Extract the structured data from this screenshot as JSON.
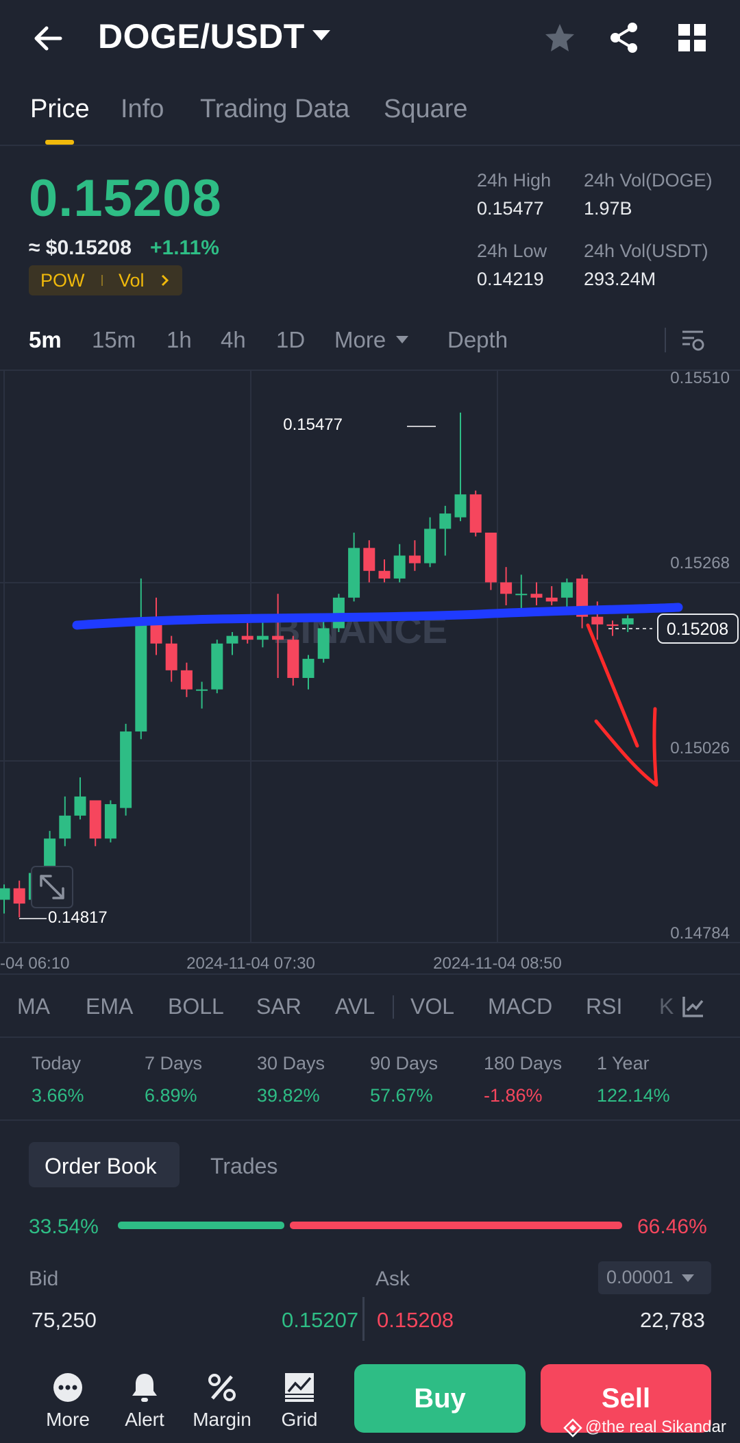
{
  "header": {
    "pair": "DOGE/USDT",
    "icons": [
      "back-arrow-icon",
      "star-icon",
      "share-icon",
      "grid-icon"
    ]
  },
  "tabs": [
    "Price",
    "Info",
    "Trading Data",
    "Square"
  ],
  "price": {
    "last": "0.15208",
    "approx": "≈ $0.15208",
    "change": "+1.11%",
    "tags": [
      "POW",
      "Vol"
    ]
  },
  "stats": {
    "high_label": "24h High",
    "high": "0.15477",
    "low_label": "24h Low",
    "low": "0.14219",
    "vol_doge_label": "24h Vol(DOGE)",
    "vol_doge": "1.97B",
    "vol_usdt_label": "24h Vol(USDT)",
    "vol_usdt": "293.24M"
  },
  "intervals": [
    "5m",
    "15m",
    "1h",
    "4h",
    "1D",
    "More",
    "Depth"
  ],
  "chart_data": {
    "type": "candlestick",
    "y_ticks": [
      "0.15510",
      "0.15268",
      "0.15026",
      "0.14784"
    ],
    "x_ticks": [
      "-04 06:10",
      "2024-11-04 07:30",
      "2024-11-04 08:50"
    ],
    "ylim": [
      0.14784,
      0.1551
    ],
    "high_marker": "0.15477",
    "low_marker": "0.14817",
    "current_price_label": "0.15208",
    "watermark": "BINANCE",
    "colors": {
      "up": "#2ebd85",
      "down": "#f6465d",
      "drawn_line": "#1f3bff",
      "drawn_arrow": "#ff2a2a"
    },
    "candles": [
      {
        "o": 0.1484,
        "h": 0.1486,
        "l": 0.14822,
        "c": 0.14855
      },
      {
        "o": 0.14855,
        "h": 0.14865,
        "l": 0.14817,
        "c": 0.14835
      },
      {
        "o": 0.1484,
        "h": 0.1488,
        "l": 0.14835,
        "c": 0.14875
      },
      {
        "o": 0.14875,
        "h": 0.1493,
        "l": 0.1487,
        "c": 0.1492
      },
      {
        "o": 0.1492,
        "h": 0.14975,
        "l": 0.1491,
        "c": 0.1495
      },
      {
        "o": 0.1495,
        "h": 0.15,
        "l": 0.14945,
        "c": 0.14975
      },
      {
        "o": 0.1497,
        "h": 0.1497,
        "l": 0.1491,
        "c": 0.1492
      },
      {
        "o": 0.1492,
        "h": 0.1497,
        "l": 0.14915,
        "c": 0.14965
      },
      {
        "o": 0.1496,
        "h": 0.1507,
        "l": 0.1495,
        "c": 0.1506
      },
      {
        "o": 0.1506,
        "h": 0.1526,
        "l": 0.1505,
        "c": 0.152
      },
      {
        "o": 0.152,
        "h": 0.15235,
        "l": 0.1516,
        "c": 0.15175
      },
      {
        "o": 0.15175,
        "h": 0.15185,
        "l": 0.15125,
        "c": 0.1514
      },
      {
        "o": 0.1514,
        "h": 0.1515,
        "l": 0.15105,
        "c": 0.15115
      },
      {
        "o": 0.15115,
        "h": 0.15125,
        "l": 0.1509,
        "c": 0.15115
      },
      {
        "o": 0.15115,
        "h": 0.1518,
        "l": 0.1511,
        "c": 0.15175
      },
      {
        "o": 0.15175,
        "h": 0.1519,
        "l": 0.1516,
        "c": 0.15185
      },
      {
        "o": 0.15185,
        "h": 0.15205,
        "l": 0.15175,
        "c": 0.1518
      },
      {
        "o": 0.1518,
        "h": 0.1521,
        "l": 0.1517,
        "c": 0.15185
      },
      {
        "o": 0.15185,
        "h": 0.1524,
        "l": 0.1513,
        "c": 0.1518
      },
      {
        "o": 0.1518,
        "h": 0.15185,
        "l": 0.1512,
        "c": 0.1513
      },
      {
        "o": 0.1513,
        "h": 0.1516,
        "l": 0.15115,
        "c": 0.15155
      },
      {
        "o": 0.15155,
        "h": 0.1521,
        "l": 0.1515,
        "c": 0.15195
      },
      {
        "o": 0.15195,
        "h": 0.1524,
        "l": 0.1519,
        "c": 0.15235
      },
      {
        "o": 0.15235,
        "h": 0.1532,
        "l": 0.1523,
        "c": 0.153
      },
      {
        "o": 0.153,
        "h": 0.1531,
        "l": 0.15255,
        "c": 0.1527
      },
      {
        "o": 0.1527,
        "h": 0.15285,
        "l": 0.15255,
        "c": 0.1526
      },
      {
        "o": 0.1526,
        "h": 0.15305,
        "l": 0.15255,
        "c": 0.1529
      },
      {
        "o": 0.1529,
        "h": 0.1531,
        "l": 0.1527,
        "c": 0.1528
      },
      {
        "o": 0.1528,
        "h": 0.1534,
        "l": 0.15275,
        "c": 0.15325
      },
      {
        "o": 0.15325,
        "h": 0.15355,
        "l": 0.1529,
        "c": 0.15345
      },
      {
        "o": 0.1534,
        "h": 0.15477,
        "l": 0.15335,
        "c": 0.1537
      },
      {
        "o": 0.1537,
        "h": 0.15375,
        "l": 0.15315,
        "c": 0.1532
      },
      {
        "o": 0.1532,
        "h": 0.1532,
        "l": 0.15245,
        "c": 0.15255
      },
      {
        "o": 0.15255,
        "h": 0.15275,
        "l": 0.15225,
        "c": 0.1524
      },
      {
        "o": 0.1524,
        "h": 0.15265,
        "l": 0.15215,
        "c": 0.1524
      },
      {
        "o": 0.1524,
        "h": 0.15255,
        "l": 0.15225,
        "c": 0.15235
      },
      {
        "o": 0.15235,
        "h": 0.1525,
        "l": 0.15225,
        "c": 0.1523
      },
      {
        "o": 0.15235,
        "h": 0.1526,
        "l": 0.1522,
        "c": 0.15255
      },
      {
        "o": 0.1526,
        "h": 0.15265,
        "l": 0.15195,
        "c": 0.1521
      },
      {
        "o": 0.1521,
        "h": 0.1523,
        "l": 0.1518,
        "c": 0.152
      },
      {
        "o": 0.152,
        "h": 0.15205,
        "l": 0.15185,
        "c": 0.15198
      },
      {
        "o": 0.152,
        "h": 0.15212,
        "l": 0.1519,
        "c": 0.15208
      }
    ]
  },
  "indicators": [
    "MA",
    "EMA",
    "BOLL",
    "SAR",
    "AVL",
    "VOL",
    "MACD",
    "RSI",
    "K"
  ],
  "performance": [
    {
      "label": "Today",
      "value": "3.66%",
      "color": "#2ebd85"
    },
    {
      "label": "7 Days",
      "value": "6.89%",
      "color": "#2ebd85"
    },
    {
      "label": "30 Days",
      "value": "39.82%",
      "color": "#2ebd85"
    },
    {
      "label": "90 Days",
      "value": "57.67%",
      "color": "#2ebd85"
    },
    {
      "label": "180 Days",
      "value": "-1.86%",
      "color": "#f6465d"
    },
    {
      "label": "1 Year",
      "value": "122.14%",
      "color": "#2ebd85"
    }
  ],
  "orderbook": {
    "tabs": [
      "Order Book",
      "Trades"
    ],
    "bid_pct": "33.54%",
    "ask_pct": "66.46%",
    "bid_fraction": 0.3354,
    "bid_label": "Bid",
    "ask_label": "Ask",
    "tick_size": "0.00001",
    "bid_qty": "75,250",
    "bid_price": "0.15207",
    "ask_price": "0.15208",
    "ask_qty": "22,783"
  },
  "bottom_nav": [
    {
      "label": "More",
      "icon": "more-icon"
    },
    {
      "label": "Alert",
      "icon": "bell-icon"
    },
    {
      "label": "Margin",
      "icon": "percent-icon"
    },
    {
      "label": "Grid",
      "icon": "grid-chart-icon"
    }
  ],
  "actions": {
    "buy": "Buy",
    "sell": "Sell"
  },
  "watermark_text": "@the real Sikandar"
}
